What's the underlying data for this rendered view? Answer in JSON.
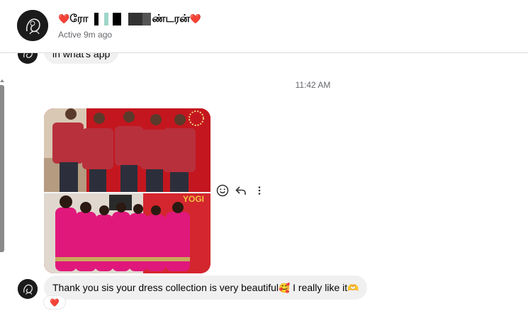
{
  "header": {
    "name_prefix_emoji": "❤️",
    "name_part1": "ரோ",
    "name_part2": "ண்டரன்",
    "name_suffix_emoji": "❤️",
    "status": "Active 9m ago"
  },
  "messages": {
    "previous_text": "in what's app",
    "timestamp": "11:42 AM",
    "main_text": "Thank you sis your dress collection is very beautiful",
    "main_emoji": "🥰",
    "main_text2": " I really like it",
    "main_emoji2": "🫶",
    "reaction": "❤️"
  },
  "photo": {
    "banner_text": "YOGI"
  },
  "actions": {
    "react_icon": "smiley-icon",
    "reply_icon": "reply-icon",
    "more_icon": "more-icon"
  },
  "colors": {
    "bubble": "#f0f0f0",
    "reaction": "#e0245e",
    "muted_text": "#65676b"
  }
}
